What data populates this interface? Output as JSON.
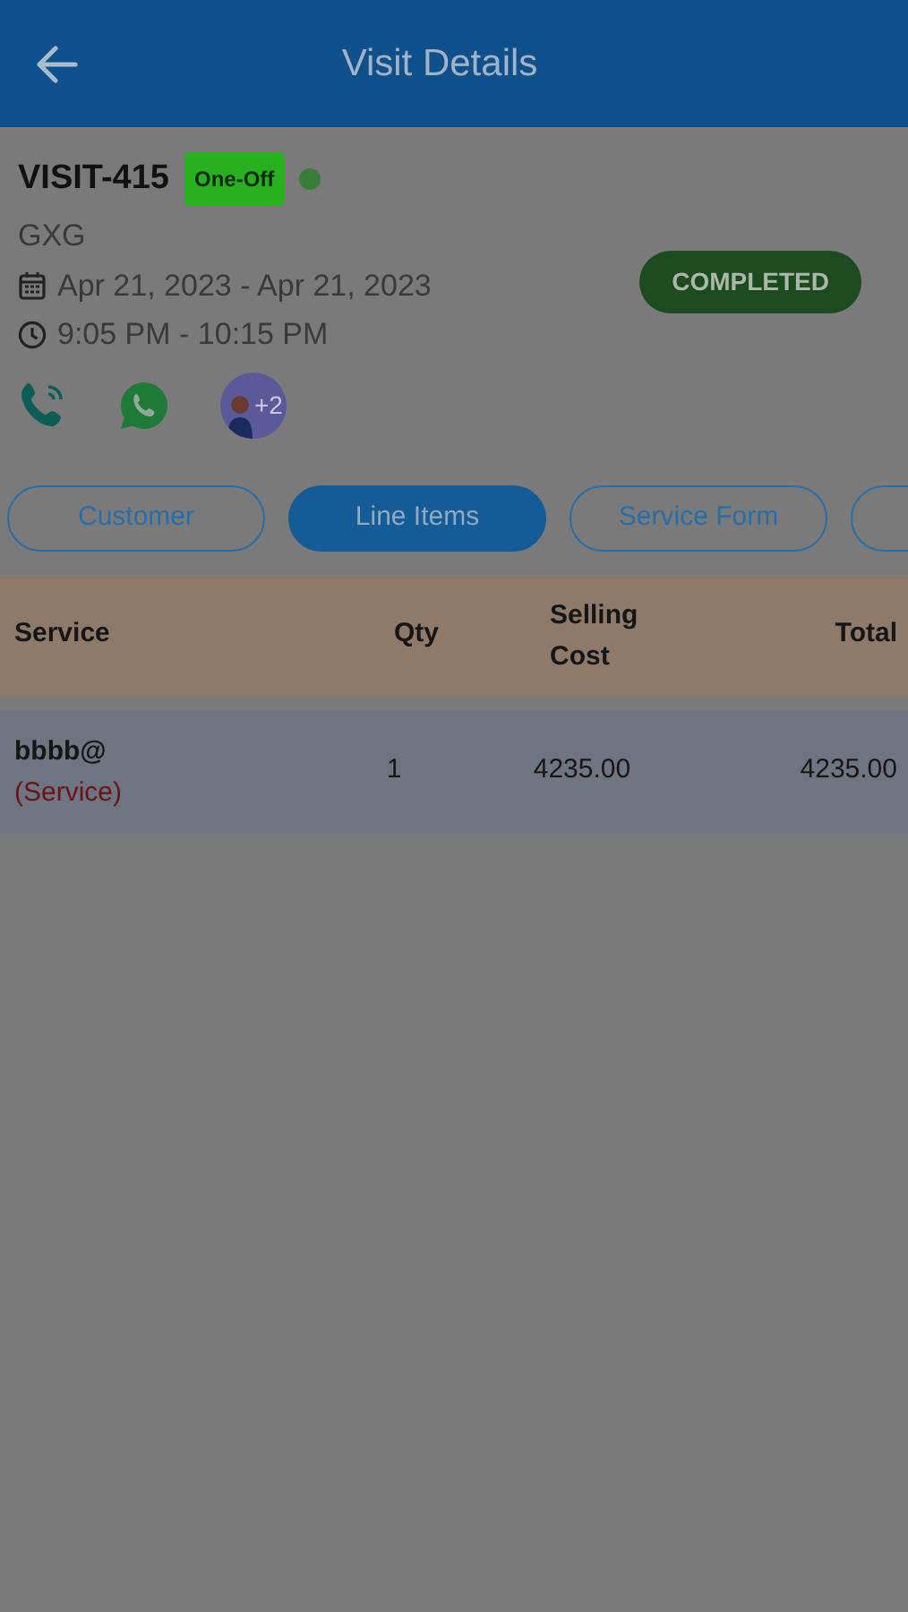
{
  "header": {
    "title": "Visit Details"
  },
  "visit": {
    "id": "VISIT-415",
    "type_badge": "One-Off",
    "online": true,
    "customer": "GXG",
    "date_range": "Apr 21, 2023 - Apr 21, 2023",
    "time_range": "9:05 PM - 10:15 PM",
    "status": "COMPLETED",
    "extra_assignees": "+2"
  },
  "tabs": [
    {
      "label": "Customer",
      "selected": false
    },
    {
      "label": "Line Items",
      "selected": true
    },
    {
      "label": "Service Form",
      "selected": false
    },
    {
      "selected": false
    }
  ],
  "table": {
    "columns": [
      "Service",
      "Qty",
      "Selling Cost",
      "Total"
    ],
    "rows": [
      {
        "name": "bbbb@",
        "kind_label": "(Service)",
        "qty": "1",
        "selling_cost": "4235.00",
        "total": "4235.00"
      }
    ]
  }
}
